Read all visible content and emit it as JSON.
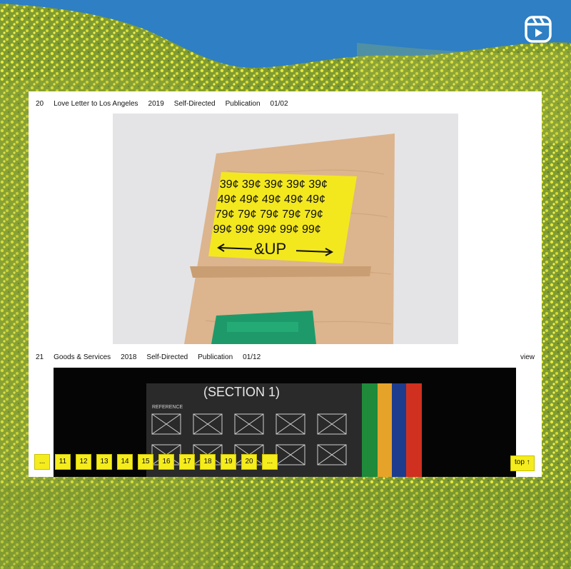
{
  "entries": [
    {
      "num": "20",
      "title": "Love Letter to Los Angeles",
      "year": "2019",
      "type": "Self-Directed",
      "category": "Publication",
      "count": "01/02"
    },
    {
      "num": "21",
      "title": "Goods & Services",
      "year": "2018",
      "type": "Self-Directed",
      "category": "Publication",
      "count": "01/12",
      "action": "view"
    }
  ],
  "poster": {
    "rows": [
      "39¢ 39¢ 39¢ 39¢ 39¢",
      "49¢ 49¢ 49¢ 49¢ 49¢",
      "79¢ 79¢ 79¢ 79¢ 79¢",
      "99¢ 99¢ 99¢ 99¢ 99¢"
    ],
    "arrow_text": "&UP"
  },
  "book": {
    "heading": "(SECTION 1)",
    "subheading": "REFERENCE"
  },
  "pagination": {
    "prev": "...",
    "pages": [
      "11",
      "12",
      "13",
      "14",
      "15",
      "16",
      "17",
      "18",
      "19",
      "20"
    ],
    "next": "...",
    "top": "top ↑"
  },
  "colors": {
    "sky": "#2e7fc4",
    "field": "#8fa63a",
    "flowers": "#e7e83a",
    "pager_yellow": "#f5ec1d",
    "poster_yellow": "#f3e81e",
    "plywood": "#dcb48e",
    "tab_green": "#1e8a3a",
    "tab_orange": "#e6a32a",
    "tab_blue": "#1d3c8e",
    "tab_red": "#d03020"
  },
  "icons": {
    "reels": "instagram-reels-icon"
  }
}
